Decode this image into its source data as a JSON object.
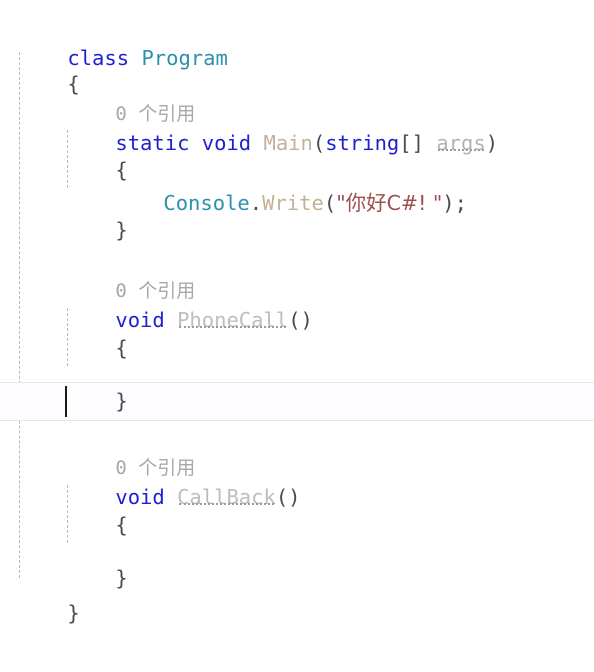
{
  "editor": {
    "language": "C#",
    "font_size_px": 20.5,
    "line_height_px": 39,
    "background": "#ffffff",
    "current_line_highlight": "#fdfdff",
    "current_line_border": "#e6e6f2",
    "caret_color": "#1a1a1a",
    "indent_guide_color": "#b9b9bd"
  },
  "colors": {
    "keyword": "#1f1fd1",
    "type": "#2b91af",
    "method": "#c3b298",
    "unreferenced": "#bdbdbd",
    "identifier": "#b3b3b3",
    "punctuation": "#4a4a52",
    "string": "#9f4f4f",
    "codelens": "#a8a8a8"
  },
  "codelens": {
    "main_refs": "0 个引用",
    "phonecall_refs": "0 个引用",
    "callback_refs": "0 个引用"
  },
  "code": {
    "l1_class_kw": "class",
    "l1_space": " ",
    "l1_name": "Program",
    "l2_brace": "{",
    "l4_static": "static",
    "l4_sp1": " ",
    "l4_void": "void",
    "l4_sp2": " ",
    "l4_name": "Main",
    "l4_open": "(",
    "l4_string_kw": "string",
    "l4_brackets": "[]",
    "l4_sp3": " ",
    "l4_arg": "args",
    "l4_close": ")",
    "l5_brace": "{",
    "l6_console": "Console",
    "l6_dot": ".",
    "l6_write": "Write",
    "l6_open": "(",
    "l6_str": "\"你好C#! \"",
    "l6_close": ");",
    "l7_brace": "}",
    "l10_void": "void",
    "l10_sp": " ",
    "l10_name": "PhoneCall",
    "l10_parens": "()",
    "l11_brace": "{",
    "l13_brace": "}",
    "l16_void": "void",
    "l16_sp": " ",
    "l16_name": "CallBack",
    "l16_parens": "()",
    "l17_brace": "{",
    "l19_brace": "}",
    "l20_brace": "}"
  }
}
